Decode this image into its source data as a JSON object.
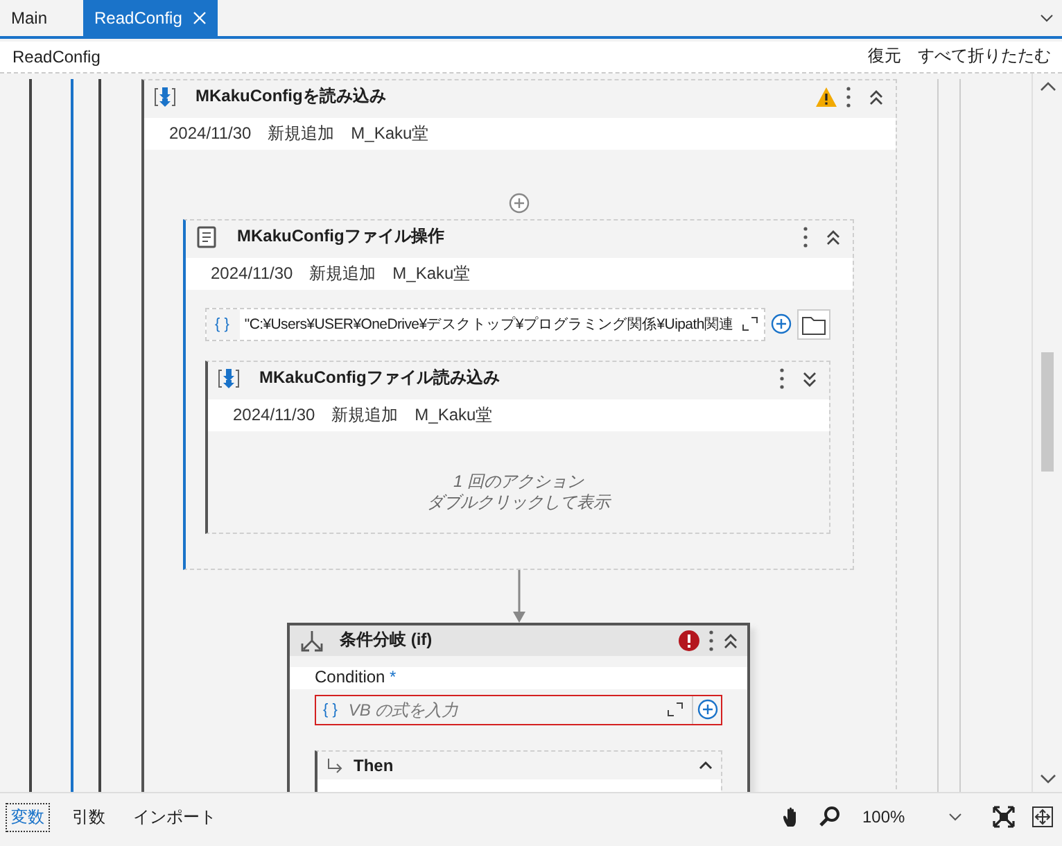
{
  "tabs": [
    {
      "label": "Main",
      "selected": false,
      "closable": false
    },
    {
      "label": "ReadConfig",
      "selected": true,
      "closable": true
    }
  ],
  "breadcrumb": "ReadConfig",
  "toolbar_actions": [
    "復元",
    "すべて折りたたむ"
  ],
  "workflow": {
    "kind": "read",
    "title": "MKakuConfigを読み込み",
    "warning": true,
    "selected": false,
    "expanded": true,
    "annotation": "2024/11/30　新規追加　M_Kaku堂",
    "children": [
      {
        "kind": "file",
        "title": "MKakuConfigファイル操作",
        "selected": true,
        "expanded": true,
        "annotation": "2024/11/30　新規追加　M_Kaku堂",
        "path_field": {
          "marker": "{ }",
          "value": "\"C:¥Users¥USER¥OneDrive¥デスクトップ¥プログラミング関係¥Uipath関連"
        },
        "children": [
          {
            "kind": "read",
            "title": "MKakuConfigファイル読み込み",
            "selected": false,
            "expanded": false,
            "annotation": "2024/11/30　新規追加　M_Kaku堂",
            "collapsed_text": [
              "1 回のアクション",
              "ダブルクリックして表示"
            ]
          }
        ]
      },
      {
        "kind": "if",
        "title": "条件分岐 (if)",
        "error": true,
        "expanded": true,
        "condition_label": "Condition",
        "required_mark": "*",
        "condition_marker": "{ }",
        "condition_placeholder": "VB の式を入力",
        "then_label": "Then",
        "then_expanded": true
      }
    ]
  },
  "bottom_tabs": [
    {
      "label": "変数",
      "selected": true
    },
    {
      "label": "引数",
      "selected": false
    },
    {
      "label": "インポート",
      "selected": false
    }
  ],
  "zoom": "100%"
}
